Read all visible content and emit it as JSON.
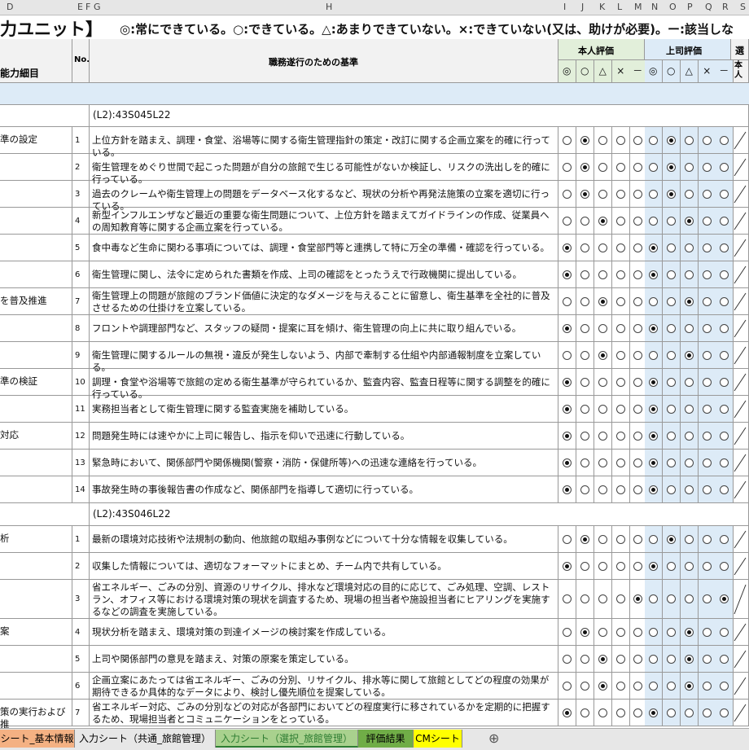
{
  "column_letters": [
    "D",
    "E",
    "F",
    "G",
    "H",
    "I",
    "J",
    "K",
    "L",
    "M",
    "N",
    "O",
    "P",
    "Q",
    "R",
    "S"
  ],
  "title": {
    "unit": "力ユニット】",
    "legend": "◎:常にできている。○:できている。△:あまりできていない。×:できていない(又は、助けが必要)。ー:該当しな"
  },
  "header": {
    "ability_detail": "能力細目",
    "no": "No.",
    "criteria": "職務遂行のための基準",
    "self_eval": "本人評価",
    "boss_eval": "上司評価",
    "extra": "選",
    "extra2": "本人",
    "symbols": [
      "◎",
      "○",
      "△",
      "×",
      "－"
    ]
  },
  "sections": [
    {
      "code": "(L2):43S045L22",
      "rows": [
        {
          "label": "準の設定",
          "no": "1",
          "text": "上位方針を踏まえ、調理・食堂、浴場等に関する衛生管理指針の策定・改訂に関する企画立案を的確に行っている。",
          "self": 1,
          "boss": 1
        },
        {
          "label": "",
          "no": "2",
          "text": "衛生管理をめぐり世間で起こった問題が自分の旅館で生じる可能性がないか検証し、リスクの洗出しを的確に行っている。",
          "self": 1,
          "boss": 1
        },
        {
          "label": "",
          "no": "3",
          "text": "過去のクレームや衛生管理上の問題をデータベース化するなど、現状の分析や再発法施策の立案を適切に行っている。",
          "self": 1,
          "boss": 1
        },
        {
          "label": "",
          "no": "4",
          "text": "新型インフルエンザなど最近の重要な衛生問題について、上位方針を踏まえてガイドラインの作成、従業員への周知教育等に関する企画立案を行っている。",
          "self": 2,
          "boss": 2
        },
        {
          "label": "",
          "no": "5",
          "text": "食中毒など生命に関わる事項については、調理・食堂部門等と連携して特に万全の準備・確認を行っている。",
          "self": 0,
          "boss": 0
        },
        {
          "label": "",
          "no": "6",
          "text": "衛生管理に関し、法令に定められた書類を作成、上司の確認をとったうえで行政機関に提出している。",
          "self": 0,
          "boss": 0
        },
        {
          "label": "を普及推進",
          "no": "7",
          "text": "衛生管理上の問題が旅館のブランド価値に決定的なダメージを与えることに留意し、衛生基準を全社的に普及させるための仕掛けを立案している。",
          "self": 2,
          "boss": 2
        },
        {
          "label": "",
          "no": "8",
          "text": "フロントや調理部門など、スタッフの疑問・提案に耳を傾け、衛生管理の向上に共に取り組んでいる。",
          "self": 0,
          "boss": 0
        },
        {
          "label": "",
          "no": "9",
          "text": "衛生管理に関するルールの無視・違反が発生しないよう、内部で牽制する仕組や内部通報制度を立案している。",
          "self": 2,
          "boss": 2
        },
        {
          "label": "準の検証",
          "no": "10",
          "text": "調理・食堂や浴場等で旅館の定める衛生基準が守られているか、監査内容、監査日程等に関する調整を的確に行っている。",
          "self": 0,
          "boss": 0
        },
        {
          "label": "",
          "no": "11",
          "text": "実務担当者として衛生管理に関する監査実施を補助している。",
          "self": 0,
          "boss": 0
        },
        {
          "label": "対応",
          "no": "12",
          "text": "問題発生時には速やかに上司に報告し、指示を仰いで迅速に行動している。",
          "self": 0,
          "boss": 0
        },
        {
          "label": "",
          "no": "13",
          "text": "緊急時において、関係部門や関係機関(警察・消防・保健所等)への迅速な連絡を行っている。",
          "self": 0,
          "boss": 0
        },
        {
          "label": "",
          "no": "14",
          "text": "事故発生時の事後報告書の作成など、関係部門を指導して適切に行っている。",
          "self": 0,
          "boss": 0
        }
      ]
    },
    {
      "code": "(L2):43S046L22",
      "rows": [
        {
          "label": "析",
          "no": "1",
          "text": "最新の環境対応技術や法規制の動向、他旅館の取組み事例などについて十分な情報を収集している。",
          "self": 1,
          "boss": 1
        },
        {
          "label": "",
          "no": "2",
          "text": "収集した情報については、適切なフォーマットにまとめ、チーム内で共有している。",
          "self": 0,
          "boss": 0
        },
        {
          "label": "",
          "no": "3",
          "text": "省エネルギー、ごみの分別、資源のリサイクル、排水など環境対応の目的に応じて、ごみ処理、空調、レストラン、オフィス等における環境対策の現状を調査するため、現場の担当者や施設担当者にヒアリングを実施するなどの調査を実施している。",
          "self": 4,
          "boss": 4
        },
        {
          "label": "案",
          "no": "4",
          "text": "現状分析を踏まえ、環境対策の到達イメージの検討案を作成している。",
          "self": 1,
          "boss": 2
        },
        {
          "label": "",
          "no": "5",
          "text": "上司や関係部門の意見を踏まえ、対策の原案を策定している。",
          "self": 2,
          "boss": 2
        },
        {
          "label": "",
          "no": "6",
          "text": "企画立案にあたっては省エネルギー、ごみの分別、リサイクル、排水等に関して旅館としてどの程度の効果が期待できるか具体的なデータにより、検討し優先順位を提案している。",
          "self": 2,
          "boss": 2
        },
        {
          "label": "策の実行および推",
          "no": "7",
          "text": "省エネルギー対応、ごみの分別などの対応が各部門においてどの程度実行に移されているかを定期的に把握するため、現場担当者とコミュニケーションをとっている。",
          "self": 0,
          "boss": 0
        }
      ]
    }
  ],
  "tabs": [
    {
      "label": "シート_基本情報",
      "color": "#f4b183"
    },
    {
      "label": "入力シート（共通_旅館管理）",
      "color": "#e7e7e7"
    },
    {
      "label": "入力シート（選択_旅館管理）",
      "color": "#a9d18e"
    },
    {
      "label": "評価結果",
      "color": "#70ad47"
    },
    {
      "label": "CMシート",
      "color": "#ffff00"
    }
  ],
  "add_sheet": "⊕"
}
